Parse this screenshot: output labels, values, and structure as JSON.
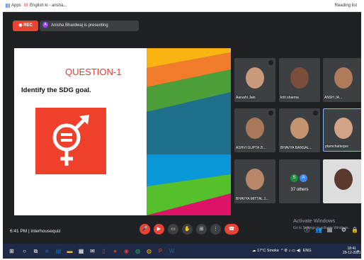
{
  "browser": {
    "bookmarks": [
      "Apps",
      "English ki - ansha..."
    ],
    "reading_list": "Reading list"
  },
  "meet": {
    "rec_label": "REC",
    "presenter_text": "Anisha Bhardwaj is presenting",
    "presenter_initial": "A",
    "slide": {
      "title": "QUESTION-1",
      "prompt": "Identify the SDG goal."
    },
    "participants": [
      {
        "name": "Aarushi Jain"
      },
      {
        "name": "kriti sharma"
      },
      {
        "name": "ANSH JA..."
      },
      {
        "name": "ASHVI GUPTA 2I..."
      },
      {
        "name": "BHAVYA BANSAL..."
      },
      {
        "name": "ptamchatterjee"
      },
      {
        "name": "BHAVYA MITTAL J..."
      },
      {
        "name": "37 others"
      },
      {
        "name": ""
      }
    ],
    "others_initials": [
      "S",
      "A"
    ],
    "time_meeting": "6:41 PM  |  interhousequiz",
    "watermark_line1": "Activate Windows",
    "watermark_line2": "Go to Settings to activate Windows."
  },
  "taskbar": {
    "weather": "17°C  Smoke",
    "lang": "ENG",
    "time": "18:41",
    "date": "29-12-2021"
  },
  "colors": {
    "rec_red": "#ea4335",
    "meet_bg": "#202124",
    "sdg_orange": "#ef402b",
    "taskbar": "#1f2b46"
  }
}
